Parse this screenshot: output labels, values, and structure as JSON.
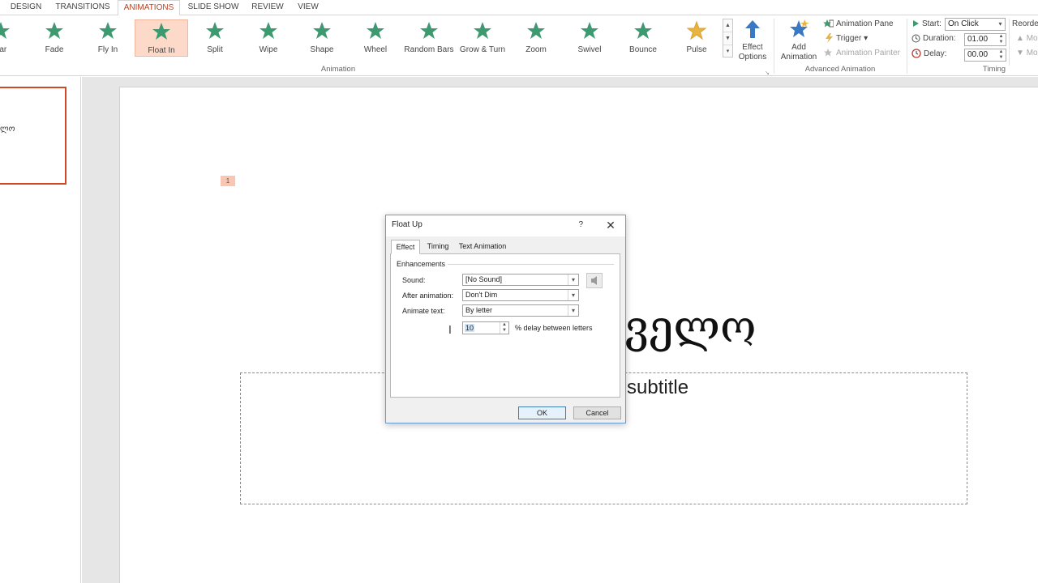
{
  "ribbon_tabs": [
    "DESIGN",
    "TRANSITIONS",
    "ANIMATIONS",
    "SLIDE SHOW",
    "REVIEW",
    "VIEW"
  ],
  "active_tab": "ANIMATIONS",
  "animation_gallery": {
    "effects": [
      "ear",
      "Fade",
      "Fly In",
      "Float In",
      "Split",
      "Wipe",
      "Shape",
      "Wheel",
      "Random Bars",
      "Grow & Turn",
      "Zoom",
      "Swivel",
      "Bounce",
      "Pulse"
    ],
    "selected": "Float In",
    "group_label": "Animation",
    "entrance_color": "#3d9970",
    "emphasis_color": "#e8b340"
  },
  "effect_options": {
    "line1": "Effect",
    "line2": "Options"
  },
  "advanced_animation": {
    "add_line1": "Add",
    "add_line2": "Animation",
    "pane": "Animation Pane",
    "trigger": "Trigger",
    "painter": "Animation Painter",
    "group_label": "Advanced Animation"
  },
  "timing": {
    "start_label": "Start:",
    "start_value": "On Click",
    "duration_label": "Duration:",
    "duration_value": "01.00",
    "delay_label": "Delay:",
    "delay_value": "00.00",
    "group_label": "Timing",
    "reorder": "Reorder",
    "move_earlier": "Mo",
    "move_later": "Mo"
  },
  "thumbnail": {
    "text": "ლო"
  },
  "slide": {
    "anim_tag": "1",
    "title": "ველო",
    "subtitle": "subtitle"
  },
  "dialog": {
    "title": "Float Up",
    "help": "?",
    "tabs": [
      "Effect",
      "Timing",
      "Text Animation"
    ],
    "active_tab": "Effect",
    "section": "Enhancements",
    "sound_label": "Sound:",
    "sound_value": "[No Sound]",
    "after_label": "After animation:",
    "after_value": "Don't Dim",
    "animate_text_label": "Animate text:",
    "animate_text_value": "By letter",
    "delay_value": "10",
    "delay_suffix": "% delay between letters",
    "ok": "OK",
    "cancel": "Cancel"
  }
}
